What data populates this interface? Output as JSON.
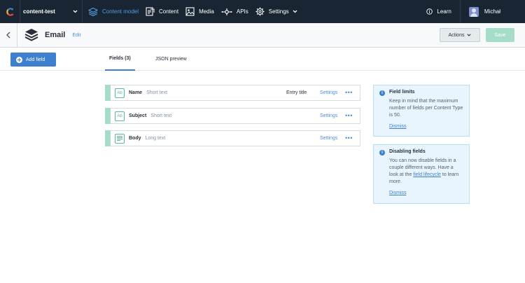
{
  "topnav": {
    "space_name": "content-test",
    "items": [
      {
        "label": "Content model",
        "icon": "layers-icon",
        "active": true
      },
      {
        "label": "Content",
        "icon": "content-icon",
        "active": false
      },
      {
        "label": "Media",
        "icon": "media-icon",
        "active": false
      },
      {
        "label": "APIs",
        "icon": "api-icon",
        "active": false
      },
      {
        "label": "Settings",
        "icon": "gear-icon",
        "active": false
      }
    ],
    "learn_label": "Learn",
    "user_name": "Michał"
  },
  "header": {
    "content_type_name": "Email",
    "edit_label": "Edit",
    "actions_label": "Actions",
    "save_label": "Save"
  },
  "toolbar": {
    "add_field_label": "Add field",
    "tabs": [
      {
        "label": "Fields (3)",
        "active": true
      },
      {
        "label": "JSON preview",
        "active": false
      }
    ]
  },
  "fields": [
    {
      "icon_text": "Ab",
      "name": "Name",
      "type": "Short text",
      "badge": "Entry title",
      "settings": "Settings",
      "more": "•••"
    },
    {
      "icon_text": "Ab",
      "name": "Subject",
      "type": "Short text",
      "badge": "",
      "settings": "Settings",
      "more": "•••"
    },
    {
      "icon_text": "",
      "name": "Body",
      "type": "Long text",
      "badge": "",
      "settings": "Settings",
      "more": "•••"
    }
  ],
  "info_boxes": [
    {
      "title": "Field limits",
      "text": "Keep in mind that the maximum number of fields per Content Type is 50.",
      "dismiss": "Dismiss"
    },
    {
      "title": "Disabling fields",
      "text_before": "You can now disable fields in a couple different ways. Have a look at the ",
      "link": "field lifecycle",
      "text_after": " to learn more.",
      "dismiss": "Dismiss"
    }
  ],
  "colors": {
    "nav_bg": "#192532",
    "accent": "#4d9fe2",
    "primary_button": "#3c80cf",
    "save_disabled": "#a6ddc9",
    "field_grip": "#a6ddc9",
    "info_bg": "#e8f5ff"
  }
}
